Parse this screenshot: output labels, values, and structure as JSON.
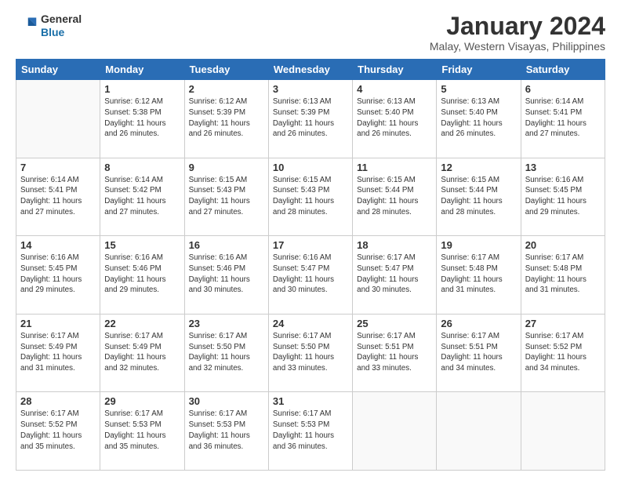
{
  "logo": {
    "general": "General",
    "blue": "Blue"
  },
  "header": {
    "title": "January 2024",
    "subtitle": "Malay, Western Visayas, Philippines"
  },
  "days_of_week": [
    "Sunday",
    "Monday",
    "Tuesday",
    "Wednesday",
    "Thursday",
    "Friday",
    "Saturday"
  ],
  "weeks": [
    [
      {
        "day": "",
        "sunrise": "",
        "sunset": "",
        "daylight": ""
      },
      {
        "day": "1",
        "sunrise": "Sunrise: 6:12 AM",
        "sunset": "Sunset: 5:38 PM",
        "daylight": "Daylight: 11 hours and 26 minutes."
      },
      {
        "day": "2",
        "sunrise": "Sunrise: 6:12 AM",
        "sunset": "Sunset: 5:39 PM",
        "daylight": "Daylight: 11 hours and 26 minutes."
      },
      {
        "day": "3",
        "sunrise": "Sunrise: 6:13 AM",
        "sunset": "Sunset: 5:39 PM",
        "daylight": "Daylight: 11 hours and 26 minutes."
      },
      {
        "day": "4",
        "sunrise": "Sunrise: 6:13 AM",
        "sunset": "Sunset: 5:40 PM",
        "daylight": "Daylight: 11 hours and 26 minutes."
      },
      {
        "day": "5",
        "sunrise": "Sunrise: 6:13 AM",
        "sunset": "Sunset: 5:40 PM",
        "daylight": "Daylight: 11 hours and 26 minutes."
      },
      {
        "day": "6",
        "sunrise": "Sunrise: 6:14 AM",
        "sunset": "Sunset: 5:41 PM",
        "daylight": "Daylight: 11 hours and 27 minutes."
      }
    ],
    [
      {
        "day": "7",
        "sunrise": "Sunrise: 6:14 AM",
        "sunset": "Sunset: 5:41 PM",
        "daylight": "Daylight: 11 hours and 27 minutes."
      },
      {
        "day": "8",
        "sunrise": "Sunrise: 6:14 AM",
        "sunset": "Sunset: 5:42 PM",
        "daylight": "Daylight: 11 hours and 27 minutes."
      },
      {
        "day": "9",
        "sunrise": "Sunrise: 6:15 AM",
        "sunset": "Sunset: 5:43 PM",
        "daylight": "Daylight: 11 hours and 27 minutes."
      },
      {
        "day": "10",
        "sunrise": "Sunrise: 6:15 AM",
        "sunset": "Sunset: 5:43 PM",
        "daylight": "Daylight: 11 hours and 28 minutes."
      },
      {
        "day": "11",
        "sunrise": "Sunrise: 6:15 AM",
        "sunset": "Sunset: 5:44 PM",
        "daylight": "Daylight: 11 hours and 28 minutes."
      },
      {
        "day": "12",
        "sunrise": "Sunrise: 6:15 AM",
        "sunset": "Sunset: 5:44 PM",
        "daylight": "Daylight: 11 hours and 28 minutes."
      },
      {
        "day": "13",
        "sunrise": "Sunrise: 6:16 AM",
        "sunset": "Sunset: 5:45 PM",
        "daylight": "Daylight: 11 hours and 29 minutes."
      }
    ],
    [
      {
        "day": "14",
        "sunrise": "Sunrise: 6:16 AM",
        "sunset": "Sunset: 5:45 PM",
        "daylight": "Daylight: 11 hours and 29 minutes."
      },
      {
        "day": "15",
        "sunrise": "Sunrise: 6:16 AM",
        "sunset": "Sunset: 5:46 PM",
        "daylight": "Daylight: 11 hours and 29 minutes."
      },
      {
        "day": "16",
        "sunrise": "Sunrise: 6:16 AM",
        "sunset": "Sunset: 5:46 PM",
        "daylight": "Daylight: 11 hours and 30 minutes."
      },
      {
        "day": "17",
        "sunrise": "Sunrise: 6:16 AM",
        "sunset": "Sunset: 5:47 PM",
        "daylight": "Daylight: 11 hours and 30 minutes."
      },
      {
        "day": "18",
        "sunrise": "Sunrise: 6:17 AM",
        "sunset": "Sunset: 5:47 PM",
        "daylight": "Daylight: 11 hours and 30 minutes."
      },
      {
        "day": "19",
        "sunrise": "Sunrise: 6:17 AM",
        "sunset": "Sunset: 5:48 PM",
        "daylight": "Daylight: 11 hours and 31 minutes."
      },
      {
        "day": "20",
        "sunrise": "Sunrise: 6:17 AM",
        "sunset": "Sunset: 5:48 PM",
        "daylight": "Daylight: 11 hours and 31 minutes."
      }
    ],
    [
      {
        "day": "21",
        "sunrise": "Sunrise: 6:17 AM",
        "sunset": "Sunset: 5:49 PM",
        "daylight": "Daylight: 11 hours and 31 minutes."
      },
      {
        "day": "22",
        "sunrise": "Sunrise: 6:17 AM",
        "sunset": "Sunset: 5:49 PM",
        "daylight": "Daylight: 11 hours and 32 minutes."
      },
      {
        "day": "23",
        "sunrise": "Sunrise: 6:17 AM",
        "sunset": "Sunset: 5:50 PM",
        "daylight": "Daylight: 11 hours and 32 minutes."
      },
      {
        "day": "24",
        "sunrise": "Sunrise: 6:17 AM",
        "sunset": "Sunset: 5:50 PM",
        "daylight": "Daylight: 11 hours and 33 minutes."
      },
      {
        "day": "25",
        "sunrise": "Sunrise: 6:17 AM",
        "sunset": "Sunset: 5:51 PM",
        "daylight": "Daylight: 11 hours and 33 minutes."
      },
      {
        "day": "26",
        "sunrise": "Sunrise: 6:17 AM",
        "sunset": "Sunset: 5:51 PM",
        "daylight": "Daylight: 11 hours and 34 minutes."
      },
      {
        "day": "27",
        "sunrise": "Sunrise: 6:17 AM",
        "sunset": "Sunset: 5:52 PM",
        "daylight": "Daylight: 11 hours and 34 minutes."
      }
    ],
    [
      {
        "day": "28",
        "sunrise": "Sunrise: 6:17 AM",
        "sunset": "Sunset: 5:52 PM",
        "daylight": "Daylight: 11 hours and 35 minutes."
      },
      {
        "day": "29",
        "sunrise": "Sunrise: 6:17 AM",
        "sunset": "Sunset: 5:53 PM",
        "daylight": "Daylight: 11 hours and 35 minutes."
      },
      {
        "day": "30",
        "sunrise": "Sunrise: 6:17 AM",
        "sunset": "Sunset: 5:53 PM",
        "daylight": "Daylight: 11 hours and 36 minutes."
      },
      {
        "day": "31",
        "sunrise": "Sunrise: 6:17 AM",
        "sunset": "Sunset: 5:53 PM",
        "daylight": "Daylight: 11 hours and 36 minutes."
      },
      {
        "day": "",
        "sunrise": "",
        "sunset": "",
        "daylight": ""
      },
      {
        "day": "",
        "sunrise": "",
        "sunset": "",
        "daylight": ""
      },
      {
        "day": "",
        "sunrise": "",
        "sunset": "",
        "daylight": ""
      }
    ]
  ]
}
